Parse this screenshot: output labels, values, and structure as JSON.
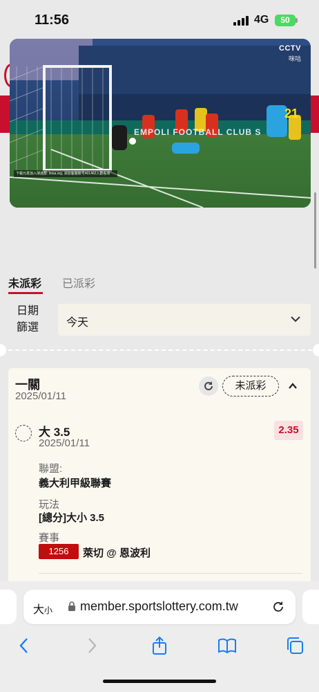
{
  "status_bar": {
    "time": "11:56",
    "network": "4G",
    "battery": "50"
  },
  "video": {
    "broadcaster": "CCTV",
    "sub_logo": "咪咕",
    "ticker": "下载元发加入球迷群: lmsa.org, 添加客服账号401462入群看球",
    "ad_board": "EMPOLI FOOTBALL CLUB S",
    "shirt_number": "21"
  },
  "tabs": {
    "active": "未派彩",
    "inactive": "已派彩"
  },
  "filter": {
    "label": "日期\n篩選",
    "value": "今天"
  },
  "bet": {
    "title": "一關",
    "date": "2025/01/11",
    "status": "未派彩",
    "pick": "大 3.5",
    "pick_date": "2025/01/11",
    "odds": "2.35",
    "league_label": "聯盟:",
    "league": "義大利甲級聯賽",
    "play_label": "玩法",
    "play": "[總分]大小 3.5",
    "match_label": "賽事",
    "match_id": "1256",
    "match": "萊切 @ 恩波利"
  },
  "browser": {
    "aa_big": "大",
    "aa_small": "小",
    "url": "member.sportslottery.com.tw"
  },
  "colors": {
    "accent": "#c8102e",
    "match_badge": "#c00d0d",
    "card_bg": "#fbf8f0"
  }
}
